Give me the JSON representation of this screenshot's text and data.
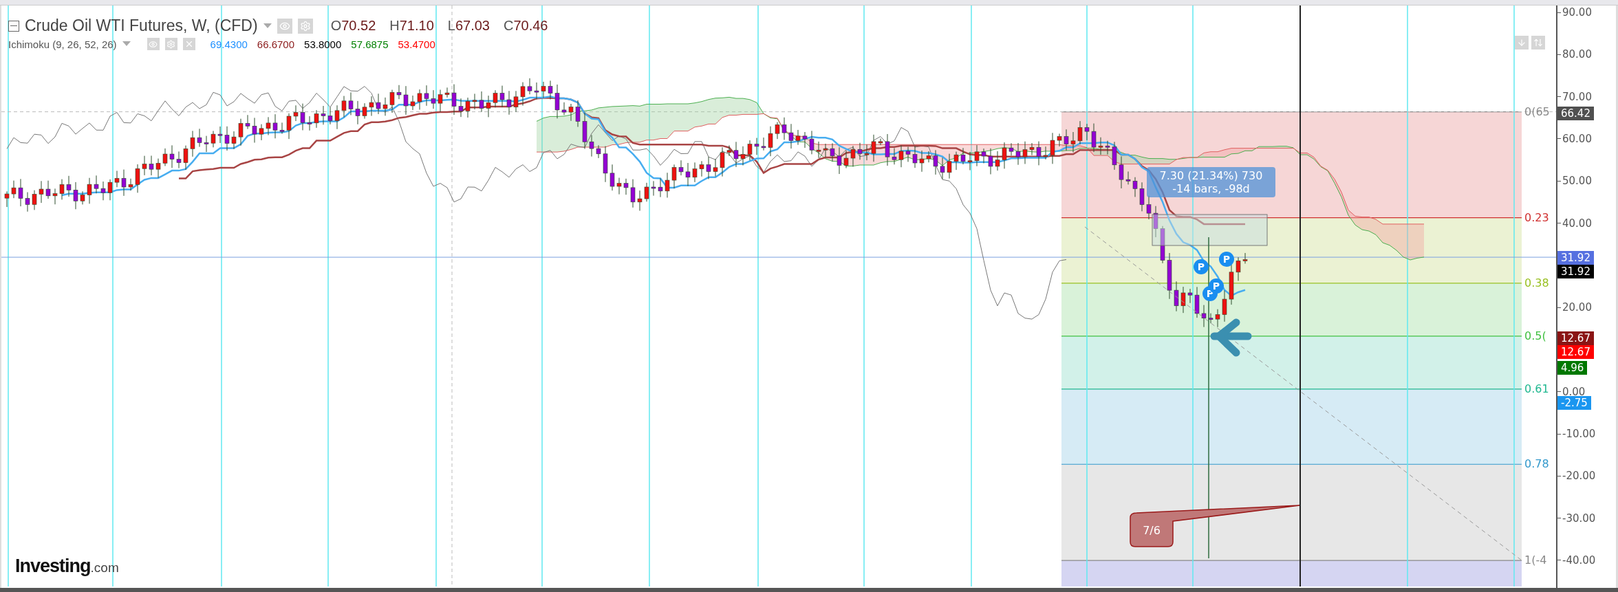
{
  "title": "Crude Oil WTI Futures, W, (CFD)",
  "ohlc": [
    {
      "key": "O",
      "value": "70.52"
    },
    {
      "key": "H",
      "value": "71.10"
    },
    {
      "key": "L",
      "value": "67.03"
    },
    {
      "key": "C",
      "value": "70.46"
    }
  ],
  "indicator": {
    "name": "Ichimoku (9, 26, 52, 26)",
    "values": [
      {
        "text": "69.4300",
        "color": "#1e90ff"
      },
      {
        "text": "66.6700",
        "color": "#8b1a1a"
      },
      {
        "text": "53.8000",
        "color": "#000000"
      },
      {
        "text": "57.6875",
        "color": "#008000"
      },
      {
        "text": "53.4700",
        "color": "#ff0000"
      }
    ]
  },
  "axis_ticks": [
    "90.00",
    "80.00",
    "70.00",
    "60.00",
    "50.00",
    "40.00",
    "20.00",
    "0.00",
    "-10.00",
    "-20.00",
    "-30.00",
    "-40.00"
  ],
  "price_tags": [
    {
      "text": "66.42",
      "color": "#505050"
    },
    {
      "text": "31.92",
      "color": "#5670e0"
    },
    {
      "text": "31.92",
      "color": "#000000"
    },
    {
      "text": "12.67",
      "color": "#8b1414"
    },
    {
      "text": "12.67",
      "color": "#ff0000"
    },
    {
      "text": "4.96",
      "color": "#007800"
    },
    {
      "text": "-2.75",
      "color": "#1a96f0"
    }
  ],
  "fib_levels": [
    {
      "label": "0(65",
      "color": "#888888"
    },
    {
      "label": "0.23",
      "color": "#d03030"
    },
    {
      "label": "0.38",
      "color": "#99c022"
    },
    {
      "label": "0.5(",
      "color": "#40c040"
    },
    {
      "label": "0.61",
      "color": "#20b890"
    },
    {
      "label": "0.78",
      "color": "#3399cc"
    },
    {
      "label": "1(-4",
      "color": "#888888"
    }
  ],
  "measure": {
    "line_1": "7.30 (21.34%) 730",
    "line_2": "-14 bars, -98d"
  },
  "markers": [
    "P",
    "P",
    "P",
    "P"
  ],
  "callout": "7/6",
  "logo": {
    "name": "Investing",
    "suffix": ".com"
  }
}
